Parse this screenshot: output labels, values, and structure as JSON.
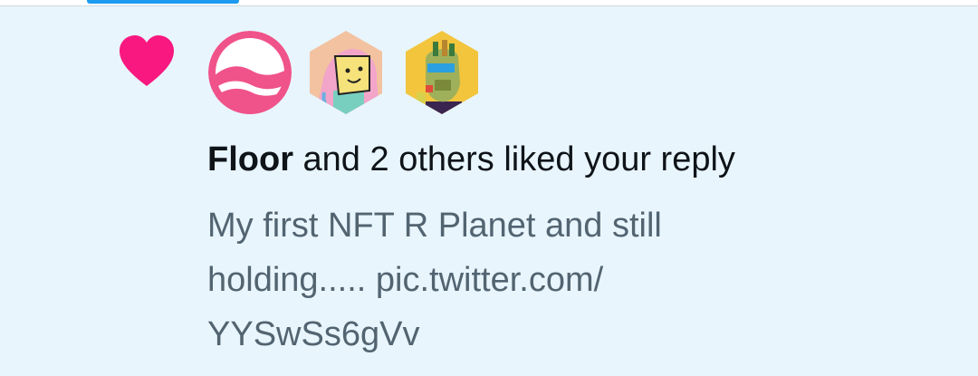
{
  "notification": {
    "type_icon": "heart-icon",
    "heart_color": "#f91880",
    "avatars": [
      {
        "name": "Floor",
        "icon": "floor-logo-avatar",
        "shape": "circle"
      },
      {
        "name": "",
        "icon": "cartoon-girl-nft-avatar",
        "shape": "hexagon"
      },
      {
        "name": "",
        "icon": "ape-nft-avatar",
        "shape": "hexagon"
      }
    ],
    "actor": "Floor",
    "action_text": " and 2 others liked your reply",
    "reply_lines": [
      "My first NFT R Planet and still",
      "holding..... pic.twitter.com/",
      "YYSwSs6gVv"
    ]
  },
  "colors": {
    "background": "#e8f5fd",
    "accent": "#1d9bf0",
    "primary_text": "#0f1419",
    "secondary_text": "#536471"
  }
}
